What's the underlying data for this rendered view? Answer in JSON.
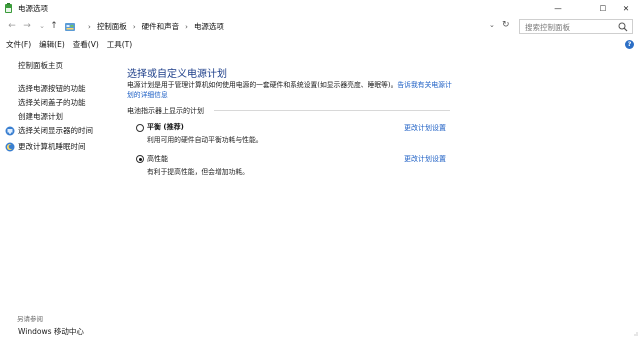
{
  "window": {
    "title": "电源选项",
    "minimize_glyph": "—",
    "maximize_glyph": "☐",
    "close_glyph": "✕"
  },
  "nav": {
    "back_glyph": "←",
    "forward_glyph": "→",
    "recent_glyph": "⌄",
    "up_glyph": "↑"
  },
  "breadcrumb": {
    "items": [
      "控制面板",
      "硬件和声音",
      "电源选项"
    ],
    "separator": "›",
    "dropdown_glyph": "⌄",
    "refresh_glyph": "↻"
  },
  "search": {
    "placeholder": "搜索控制面板"
  },
  "menu": {
    "items": [
      "文件(F)",
      "编辑(E)",
      "查看(V)",
      "工具(T)"
    ],
    "help_glyph": "?"
  },
  "sidebar": {
    "home": "控制面板主页",
    "links": [
      "选择电源按钮的功能",
      "选择关闭盖子的功能",
      "创建电源计划",
      "选择关闭显示器的时间",
      "更改计算机睡眠时间"
    ],
    "see_also_label": "另请参阅",
    "see_also_link": "Windows 移动中心"
  },
  "main": {
    "title": "选择或自定义电源计划",
    "description_text": "电源计划是用于管理计算机如何使用电源的一套硬件和系统设置(如显示器亮度、睡眠等)。",
    "description_link": "告诉我有关电源计划的详细信息",
    "section_heading": "电池指示器上显示的计划",
    "plans": [
      {
        "name": "平衡 (推荐)",
        "description": "利用可用的硬件自动平衡功耗与性能。",
        "selected": false,
        "change_link": "更改计划设置"
      },
      {
        "name": "高性能",
        "description": "有利于提高性能，但会增加功耗。",
        "selected": true,
        "change_link": "更改计划设置"
      }
    ]
  },
  "colors": {
    "title_blue": "#1e3f8a",
    "link_blue": "#1a5dc4",
    "muted_gray": "#6d6d6d"
  }
}
